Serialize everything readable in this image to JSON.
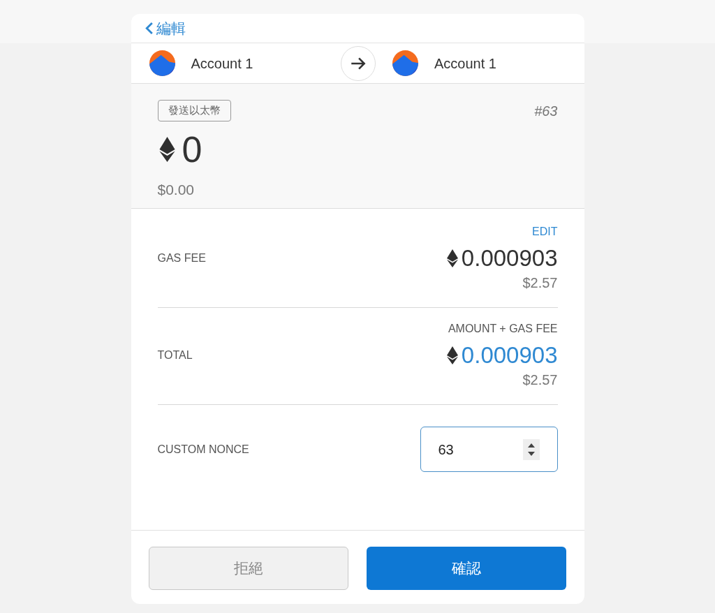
{
  "header": {
    "back_label": "編輯"
  },
  "accounts": {
    "from": "Account 1",
    "to": "Account 1"
  },
  "summary": {
    "action": "發送以太幣",
    "nonce_label": "#63",
    "amount": "0",
    "fiat": "$0.00"
  },
  "gas_fee": {
    "action": "EDIT",
    "label": "GAS FEE",
    "amount": "0.000903",
    "fiat": "$2.57"
  },
  "total": {
    "note": "AMOUNT + GAS FEE",
    "label": "TOTAL",
    "amount": "0.000903",
    "fiat": "$2.57"
  },
  "custom_nonce": {
    "label": "CUSTOM NONCE",
    "value": "63"
  },
  "buttons": {
    "reject": "拒絕",
    "confirm": "確認"
  }
}
